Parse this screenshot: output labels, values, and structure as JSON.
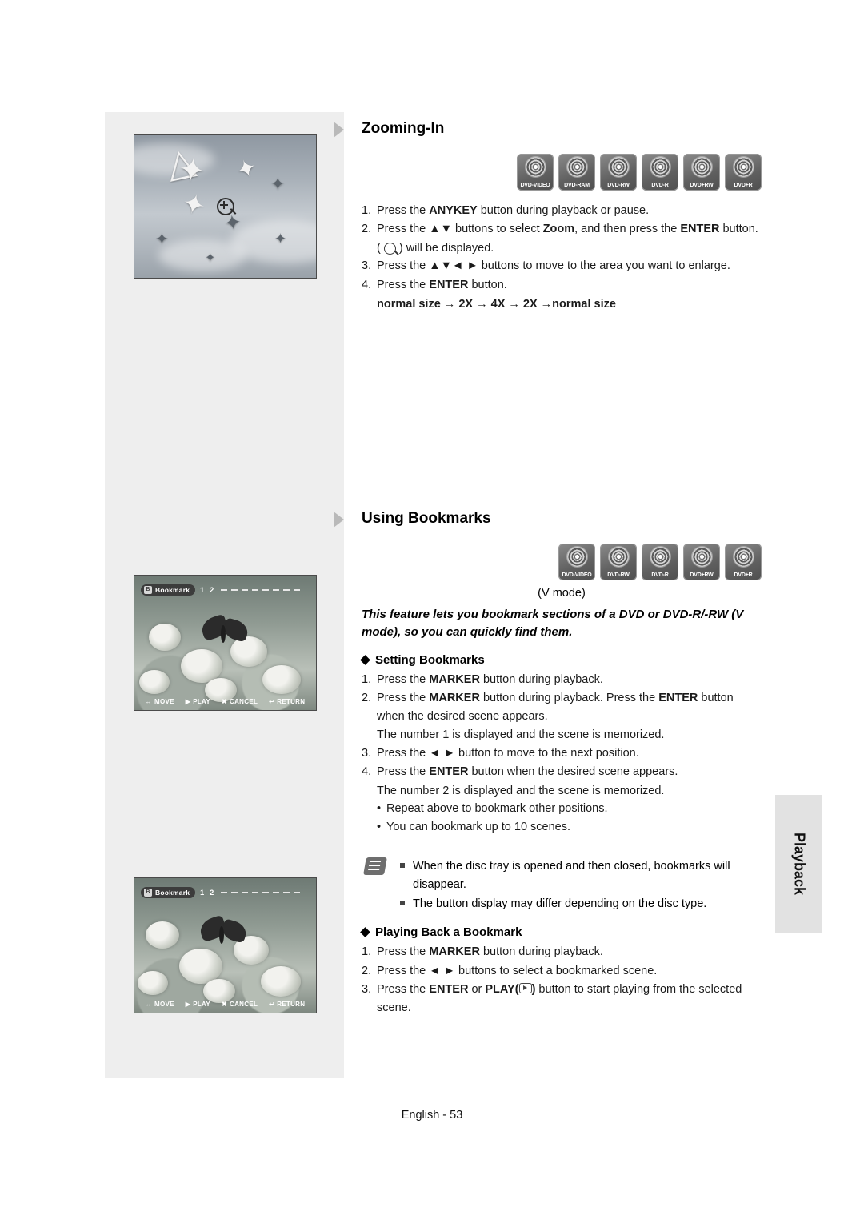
{
  "page": {
    "footer": "English - 53",
    "side_tab": "Playback"
  },
  "sections": [
    {
      "id": "zooming-in",
      "title": "Zooming-In",
      "badges": [
        {
          "label": "DVD-VIDEO"
        },
        {
          "label": "DVD-RAM"
        },
        {
          "label": "DVD-RW"
        },
        {
          "label": "DVD-R"
        },
        {
          "label": "DVD+RW"
        },
        {
          "label": "DVD+R"
        }
      ],
      "steps": [
        {
          "num": "1.",
          "text": "Press the ANYKEY button during playback or pause."
        },
        {
          "num": "2.",
          "text": "Press the ▲▼ buttons to select Zoom, and then press the ENTER button."
        },
        {
          "num": "3.",
          "text": "Press the ▲▼◄ ► buttons to move to the area you want to enlarge."
        },
        {
          "num": "4.",
          "text": "Press the ENTER button."
        }
      ],
      "magnify_note": ") will be displayed.",
      "magnify_prefix": "(",
      "zoom_sequence": "normal size → 2X → 4X → 2X →normal size"
    },
    {
      "id": "using-bookmarks",
      "title": "Using Bookmarks",
      "badges": [
        {
          "label": "DVD-VIDEO"
        },
        {
          "label": "DVD-RW"
        },
        {
          "label": "DVD-R"
        },
        {
          "label": "DVD+RW"
        },
        {
          "label": "DVD+R"
        }
      ],
      "vmode": "(V mode)",
      "intro": "This feature lets you bookmark sections of a DVD or DVD-R/-RW (V mode), so you can quickly find them.",
      "sub1": {
        "title": "Setting Bookmarks",
        "steps": [
          {
            "num": "1.",
            "text": "Press the MARKER button during playback."
          },
          {
            "num": "2.",
            "text": "Press the MARKER button during playback. Press the ENTER button when the desired scene appears."
          },
          {
            "num": "",
            "text": "The number 1 is displayed and the scene is memorized."
          },
          {
            "num": "3.",
            "text": "Press the ◄ ► button to move to the next position."
          },
          {
            "num": "4.",
            "text": "Press the ENTER button when the desired scene appears."
          },
          {
            "num": "",
            "text": "The number 2 is displayed and the scene is memorized."
          }
        ],
        "bullets": [
          "Repeat above to bookmark other positions.",
          "You can bookmark up to 10 scenes."
        ]
      },
      "notes": [
        "When the disc tray is opened and then closed, bookmarks will disappear.",
        "The button display may differ depending on the disc type."
      ],
      "sub2": {
        "title": "Playing Back a Bookmark",
        "steps": [
          {
            "num": "1.",
            "text": "Press the MARKER button during playback."
          },
          {
            "num": "2.",
            "text": "Press the ◄ ► buttons to select a bookmarked scene."
          },
          {
            "num": "3.",
            "text": "Press the ENTER or PLAY(   ) button to start playing from the selected scene."
          }
        ]
      }
    }
  ],
  "screenshots": {
    "birds": {
      "caption": ""
    },
    "bookmark_osd": {
      "pill_label": "Bookmark",
      "pill_icon": "B",
      "numbers": [
        "1",
        "2"
      ],
      "dash_count": 8,
      "buttons": [
        {
          "icon": "↔",
          "label": "MOVE"
        },
        {
          "icon": "▶",
          "label": "PLAY"
        },
        {
          "icon": "✖",
          "label": "CANCEL"
        },
        {
          "icon": "↩",
          "label": "RETURN"
        }
      ]
    }
  }
}
